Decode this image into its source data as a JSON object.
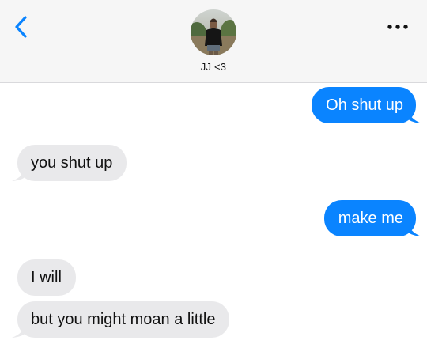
{
  "header": {
    "contact_name": "JJ <3",
    "colors": {
      "background": "#f6f6f6",
      "accent": "#0a84ff"
    },
    "icons": {
      "back": "chevron-left-icon",
      "more": "ellipsis-icon"
    }
  },
  "messages": [
    {
      "direction": "sent",
      "text": "Oh shut up"
    },
    {
      "direction": "received",
      "text": "you shut up"
    },
    {
      "direction": "sent",
      "text": "make me"
    },
    {
      "direction": "received",
      "text": "I will"
    },
    {
      "direction": "received",
      "text": "but you might moan a little"
    }
  ],
  "colors": {
    "sent_bubble": "#0a84ff",
    "received_bubble": "#e9e9eb",
    "sent_text": "#ffffff",
    "received_text": "#111111"
  }
}
